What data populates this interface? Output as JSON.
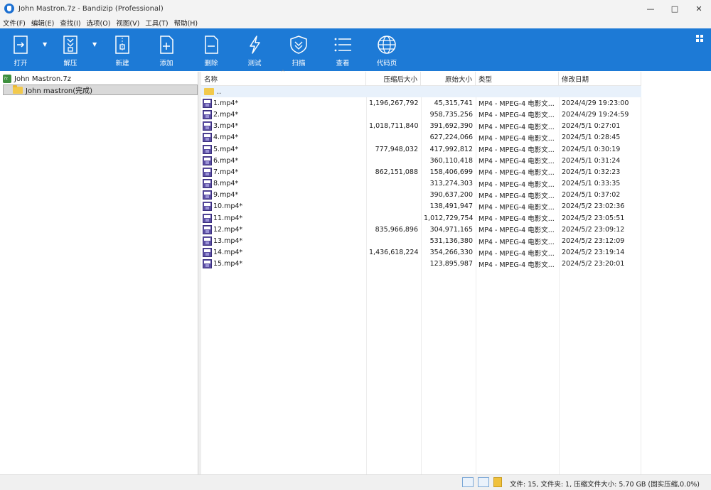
{
  "window": {
    "title": "John Mastron.7z - Bandizip (Professional)",
    "controls": [
      "—",
      "□",
      "✕"
    ]
  },
  "menu": [
    "文件(F)",
    "编辑(E)",
    "查找(I)",
    "选项(O)",
    "视图(V)",
    "工具(T)",
    "帮助(H)"
  ],
  "toolbar": {
    "open": "打开",
    "extract": "解压",
    "new": "新建",
    "add": "添加",
    "delete": "删除",
    "test": "测试",
    "scan": "扫描",
    "view": "查看",
    "codepage": "代码页"
  },
  "tree": {
    "root": "John Mastron.7z",
    "child": "John mastron(完成)"
  },
  "columns": {
    "name": "名称",
    "compressed": "压缩后大小",
    "original": "原始大小",
    "type": "类型",
    "modified": "修改日期"
  },
  "parent_entry": "..",
  "files": [
    {
      "name": "1.mp4*",
      "compressed": "1,196,267,792",
      "original": "45,315,741",
      "type": "MP4 - MPEG-4 电影文...",
      "modified": "2024/4/29 19:23:00"
    },
    {
      "name": "2.mp4*",
      "compressed": "",
      "original": "958,735,256",
      "type": "MP4 - MPEG-4 电影文...",
      "modified": "2024/4/29 19:24:59"
    },
    {
      "name": "3.mp4*",
      "compressed": "1,018,711,840",
      "original": "391,692,390",
      "type": "MP4 - MPEG-4 电影文...",
      "modified": "2024/5/1 0:27:01"
    },
    {
      "name": "4.mp4*",
      "compressed": "",
      "original": "627,224,066",
      "type": "MP4 - MPEG-4 电影文...",
      "modified": "2024/5/1 0:28:45"
    },
    {
      "name": "5.mp4*",
      "compressed": "777,948,032",
      "original": "417,992,812",
      "type": "MP4 - MPEG-4 电影文...",
      "modified": "2024/5/1 0:30:19"
    },
    {
      "name": "6.mp4*",
      "compressed": "",
      "original": "360,110,418",
      "type": "MP4 - MPEG-4 电影文...",
      "modified": "2024/5/1 0:31:24"
    },
    {
      "name": "7.mp4*",
      "compressed": "862,151,088",
      "original": "158,406,699",
      "type": "MP4 - MPEG-4 电影文...",
      "modified": "2024/5/1 0:32:23"
    },
    {
      "name": "8.mp4*",
      "compressed": "",
      "original": "313,274,303",
      "type": "MP4 - MPEG-4 电影文...",
      "modified": "2024/5/1 0:33:35"
    },
    {
      "name": "9.mp4*",
      "compressed": "",
      "original": "390,637,200",
      "type": "MP4 - MPEG-4 电影文...",
      "modified": "2024/5/1 0:37:02"
    },
    {
      "name": "10.mp4*",
      "compressed": "",
      "original": "138,491,947",
      "type": "MP4 - MPEG-4 电影文...",
      "modified": "2024/5/2 23:02:36"
    },
    {
      "name": "11.mp4*",
      "compressed": "",
      "original": "1,012,729,754",
      "type": "MP4 - MPEG-4 电影文...",
      "modified": "2024/5/2 23:05:51"
    },
    {
      "name": "12.mp4*",
      "compressed": "835,966,896",
      "original": "304,971,165",
      "type": "MP4 - MPEG-4 电影文...",
      "modified": "2024/5/2 23:09:12"
    },
    {
      "name": "13.mp4*",
      "compressed": "",
      "original": "531,136,380",
      "type": "MP4 - MPEG-4 电影文...",
      "modified": "2024/5/2 23:12:09"
    },
    {
      "name": "14.mp4*",
      "compressed": "1,436,618,224",
      "original": "354,266,330",
      "type": "MP4 - MPEG-4 电影文...",
      "modified": "2024/5/2 23:19:14"
    },
    {
      "name": "15.mp4*",
      "compressed": "",
      "original": "123,895,987",
      "type": "MP4 - MPEG-4 电影文...",
      "modified": "2024/5/2 23:20:01"
    }
  ],
  "status": "文件: 15, 文件夹: 1, 压缩文件大小: 5.70 GB (固实压缩,0.0%)",
  "colors": {
    "toolbar": "#1d7ad6",
    "selection": "#d9d9d9",
    "parent_row": "#e8f1fb"
  }
}
